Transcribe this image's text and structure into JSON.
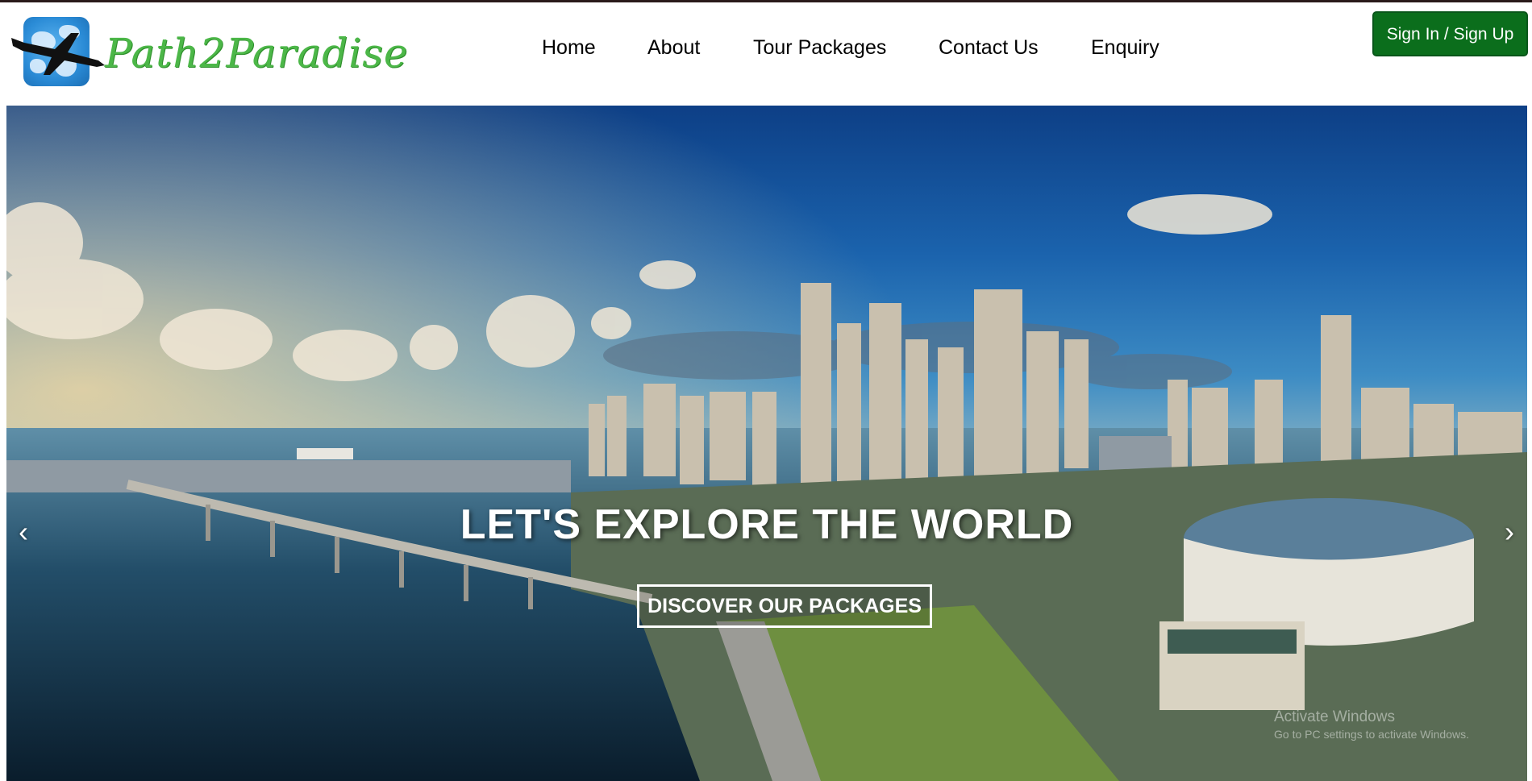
{
  "brand": {
    "name": "Path2Paradise",
    "logo_icon": "globe-with-airplane-icon",
    "color": "#4cb748"
  },
  "nav": {
    "items": [
      {
        "label": "Home"
      },
      {
        "label": "About"
      },
      {
        "label": "Tour Packages"
      },
      {
        "label": "Contact Us"
      },
      {
        "label": "Enquiry"
      }
    ]
  },
  "auth": {
    "button_label": "Sign In / Sign Up",
    "button_color": "#0b6e1c"
  },
  "hero": {
    "title": "LET'S EXPLORE THE WORLD",
    "cta_label": "DISCOVER OUR PACKAGES",
    "prev_icon": "chevron-left-icon",
    "prev_glyph": "‹",
    "next_icon": "chevron-right-icon",
    "next_glyph": "›"
  },
  "watermark": {
    "line1": "Activate Windows",
    "line2": "Go to PC settings to activate Windows."
  }
}
